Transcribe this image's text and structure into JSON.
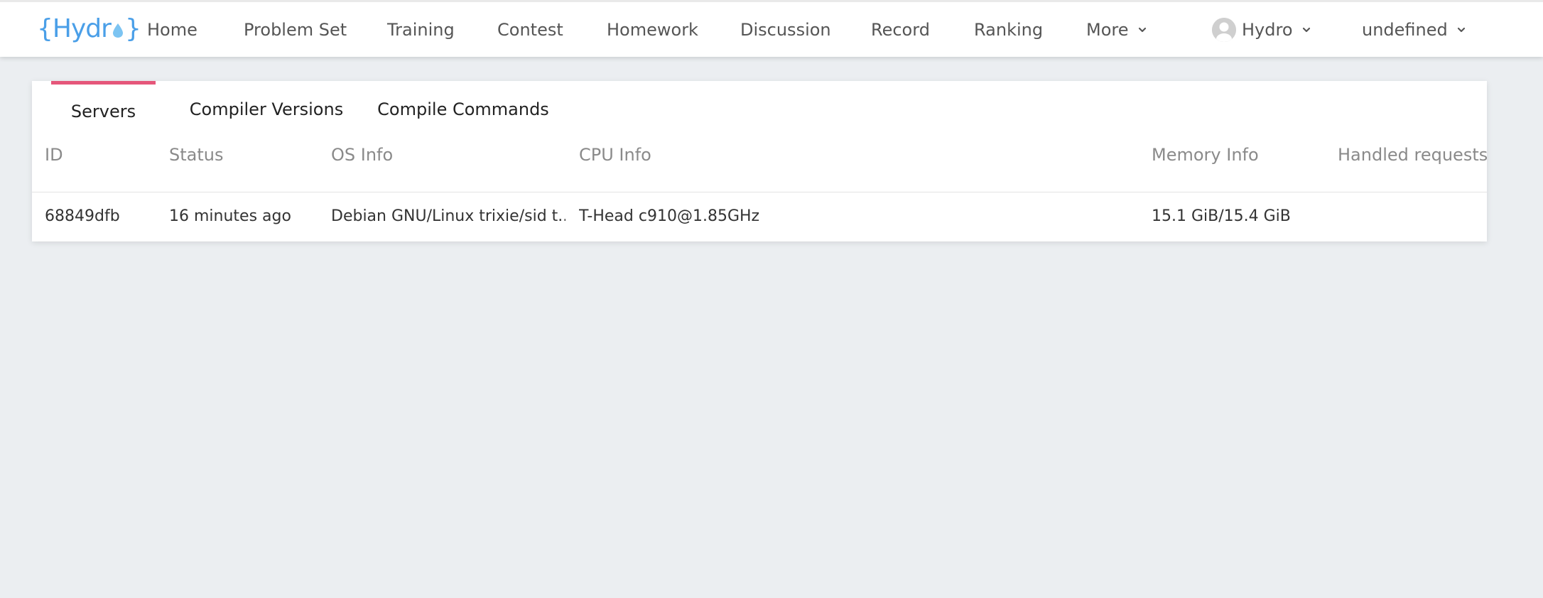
{
  "nav": {
    "logo_text": "{Hydr",
    "logo_close": "}",
    "items": [
      {
        "label": "Home"
      },
      {
        "label": "Problem Set"
      },
      {
        "label": "Training"
      },
      {
        "label": "Contest"
      },
      {
        "label": "Homework"
      },
      {
        "label": "Discussion"
      },
      {
        "label": "Record"
      },
      {
        "label": "Ranking"
      },
      {
        "label": "More"
      }
    ],
    "user": {
      "name": "Hydro"
    },
    "lang": {
      "label": "undefined"
    }
  },
  "tabs": [
    {
      "label": "Servers",
      "active": true
    },
    {
      "label": "Compiler Versions",
      "active": false
    },
    {
      "label": "Compile Commands",
      "active": false
    }
  ],
  "table": {
    "columns": [
      "ID",
      "Status",
      "OS Info",
      "CPU Info",
      "Memory Info",
      "Handled requests"
    ],
    "rows": [
      [
        "68849dfb",
        "16 minutes ago",
        "Debian GNU/Linux trixie/sid t...",
        "T-Head c910@1.85GHz",
        "15.1 GiB/15.4 GiB",
        ""
      ]
    ]
  },
  "colors": {
    "accent": "#e5577a",
    "logo": "#4a9fe8",
    "background": "#ebeef1"
  },
  "icons": {
    "chevron": "chevron-down-icon",
    "avatar": "avatar-icon",
    "logo_drop": "water-drop-icon"
  }
}
